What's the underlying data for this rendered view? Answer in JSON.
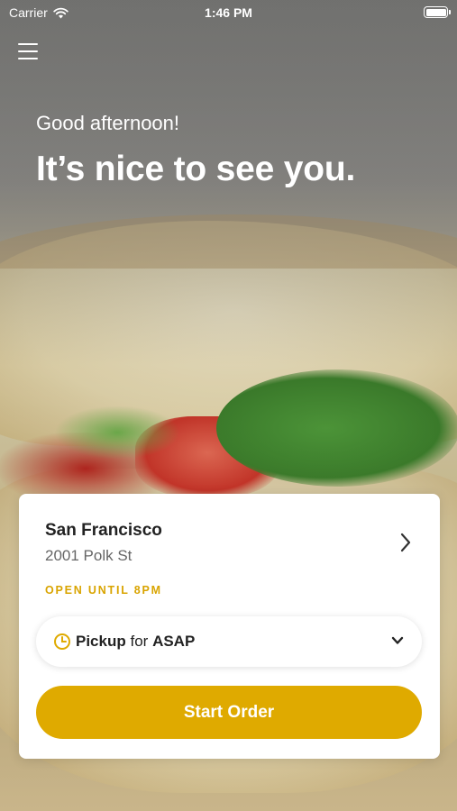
{
  "status_bar": {
    "carrier": "Carrier",
    "time": "1:46 PM"
  },
  "header": {
    "greeting": "Good afternoon!",
    "headline": "It’s nice to see you."
  },
  "location_card": {
    "city": "San Francisco",
    "address": "2001 Polk St",
    "hours": "OPEN UNTIL 8PM",
    "pickup": {
      "mode": "Pickup",
      "connector": "for",
      "time": "ASAP"
    },
    "start_order_label": "Start Order"
  },
  "colors": {
    "accent": "#dfaa00",
    "hours_text": "#d9a400"
  },
  "icons": [
    "wifi-icon",
    "battery-icon",
    "menu-icon",
    "chevron-right-icon",
    "clock-icon",
    "chevron-down-icon"
  ]
}
